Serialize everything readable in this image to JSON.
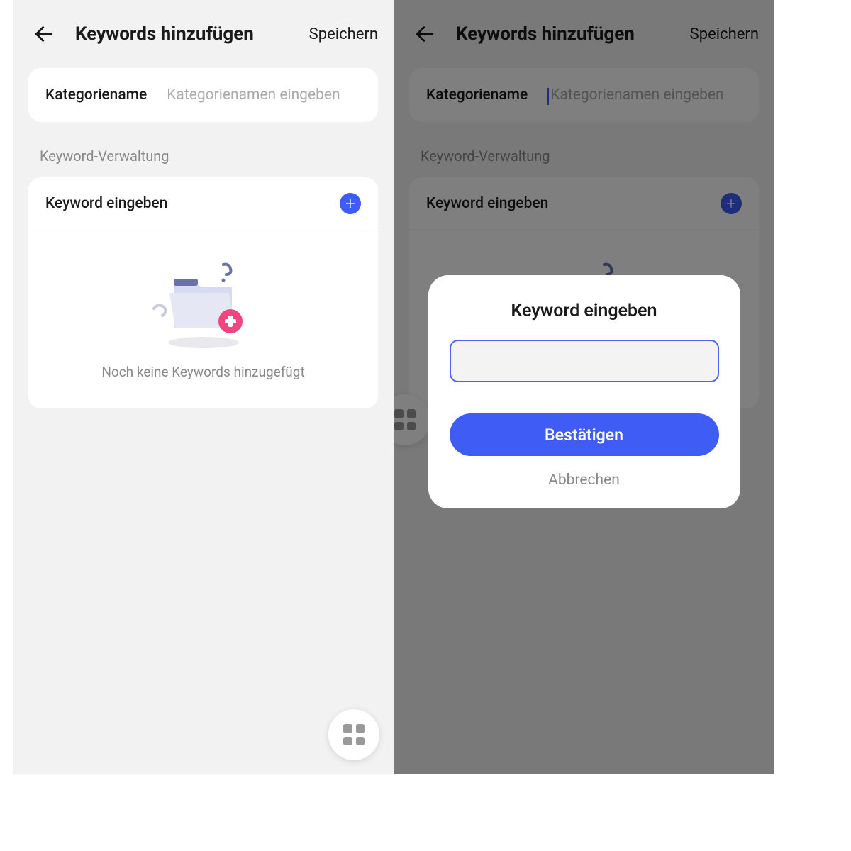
{
  "header": {
    "title": "Keywords hinzufügen",
    "save": "Speichern"
  },
  "category": {
    "label": "Kategoriename",
    "placeholder": "Kategorienamen eingeben"
  },
  "section": "Keyword-Verwaltung",
  "keyword": {
    "label": "Keyword eingeben"
  },
  "empty": "Noch keine Keywords hinzugefügt",
  "modal": {
    "title": "Keyword eingeben",
    "confirm": "Bestätigen",
    "cancel": "Abbrechen"
  },
  "icons": {
    "back": "arrow-left",
    "plus": "plus-circle",
    "grid": "grid-4"
  },
  "colors": {
    "primary": "#3f5cf5",
    "accent_pink": "#f0457f",
    "bg": "#f2f2f3",
    "text_muted": "#888"
  }
}
